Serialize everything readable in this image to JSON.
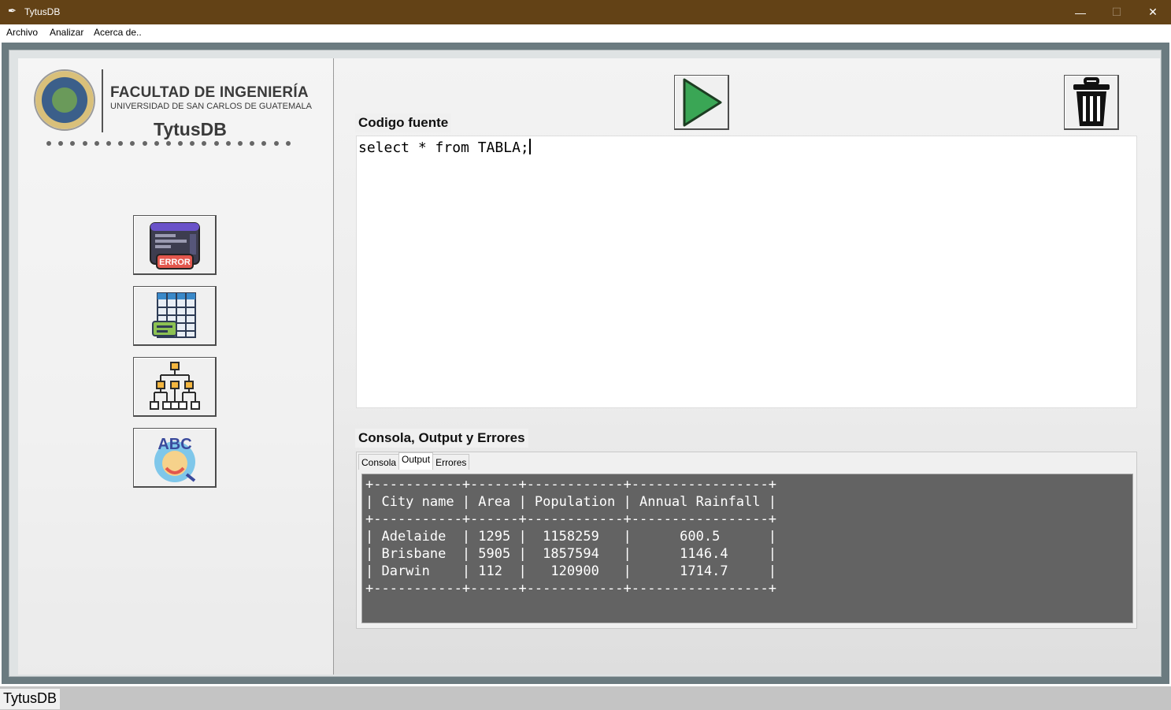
{
  "window": {
    "title": "TytusDB",
    "minimize": "—",
    "maximize": "☐",
    "close": "✕"
  },
  "menu": {
    "items": [
      "Archivo",
      "Analizar",
      "Acerca de.."
    ]
  },
  "branding": {
    "faculty": "FACULTAD DE INGENIERÍA",
    "university": "UNIVERSIDAD DE SAN CARLOS DE GUATEMALA",
    "app": "TytusDB"
  },
  "sidebar": {
    "buttons": [
      "error-report-icon",
      "symbol-table-icon",
      "ast-tree-icon",
      "grammar-report-icon"
    ],
    "error_badge": "ERROR",
    "abc_label": "ABC"
  },
  "editor": {
    "label": "Codigo fuente",
    "code": "select * from TABLA;"
  },
  "console": {
    "label": "Consola, Output y Errores",
    "tabs": [
      "Consola",
      "Output",
      "Errores"
    ],
    "active_tab": "Output",
    "output_lines": [
      "+-----------+------+------------+-----------------+",
      "| City name | Area | Population | Annual Rainfall |",
      "+-----------+------+------------+-----------------+",
      "| Adelaide  | 1295 |  1158259   |      600.5      |",
      "| Brisbane  | 5905 |  1857594   |      1146.4     |",
      "| Darwin    | 112  |   120900   |      1714.7     |",
      "+-----------+------+------------+-----------------+"
    ]
  },
  "statusbar": {
    "text": "TytusDB"
  },
  "colors": {
    "titlebar": "#634216",
    "run_green": "#3aa655",
    "console_bg": "#636363"
  }
}
